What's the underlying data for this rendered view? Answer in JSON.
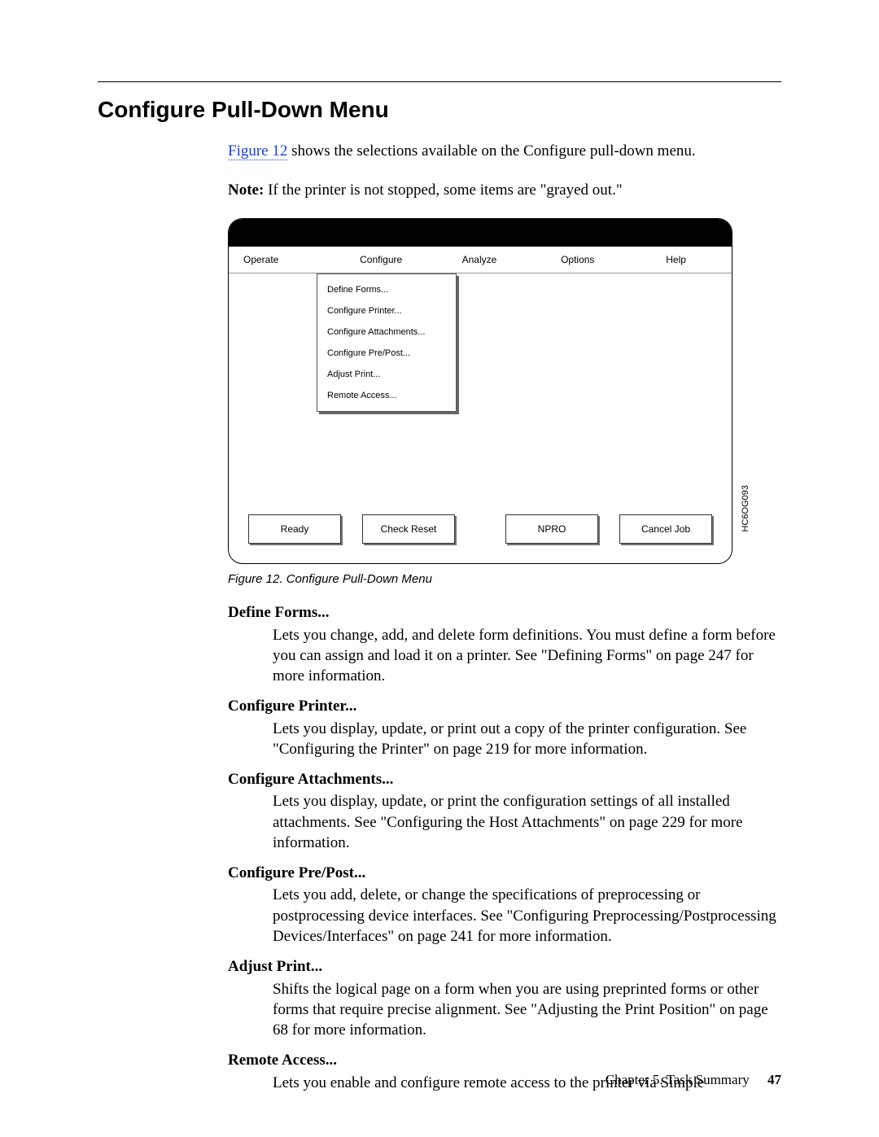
{
  "section_title": "Configure Pull-Down Menu",
  "intro": {
    "figref": "Figure 12",
    "after_ref": " shows the selections available on the Configure pull-down menu.",
    "note_label": "Note:",
    "note_body": " If the printer is not stopped, some items are \"grayed out.\""
  },
  "figure": {
    "menubar": [
      "Operate",
      "Configure",
      "Analyze",
      "Options",
      "Help"
    ],
    "dropdown": [
      "Define Forms...",
      "Configure Printer...",
      "Configure Attachments...",
      "Configure Pre/Post...",
      "Adjust Print...",
      "Remote Access..."
    ],
    "buttons": {
      "ready": "Ready",
      "check_reset": "Check Reset",
      "npro": "NPRO",
      "cancel_job": "Cancel Job"
    },
    "side_code": "HC6OG093",
    "caption": "Figure 12. Configure Pull-Down Menu"
  },
  "defs": [
    {
      "term": "Define Forms...",
      "desc": "Lets you change, add, and delete form definitions. You must define a form before you can assign and load it on a printer. See \"Defining Forms\" on page 247 for more information."
    },
    {
      "term": "Configure Printer...",
      "desc": "Lets you display, update, or print out a copy of the printer configuration. See \"Configuring the Printer\" on page 219 for more information."
    },
    {
      "term": "Configure Attachments...",
      "desc": "Lets you display, update, or print the configuration settings of all installed attachments. See \"Configuring the Host Attachments\" on page 229 for more information."
    },
    {
      "term": "Configure Pre/Post...",
      "desc": "Lets you add, delete, or change the specifications of preprocessing or postprocessing device interfaces. See \"Configuring Preprocessing/Postprocessing Devices/Interfaces\" on page 241 for more information."
    },
    {
      "term": "Adjust Print...",
      "desc": "Shifts the logical page on a form when you are using preprinted forms or other forms that require precise alignment. See \"Adjusting the Print Position\" on page 68 for more information."
    },
    {
      "term": "Remote Access...",
      "desc": "Lets you enable and configure remote access to the printer via Simple"
    }
  ],
  "footer": {
    "chapter": "Chapter 5. Task Summary",
    "page": "47"
  }
}
